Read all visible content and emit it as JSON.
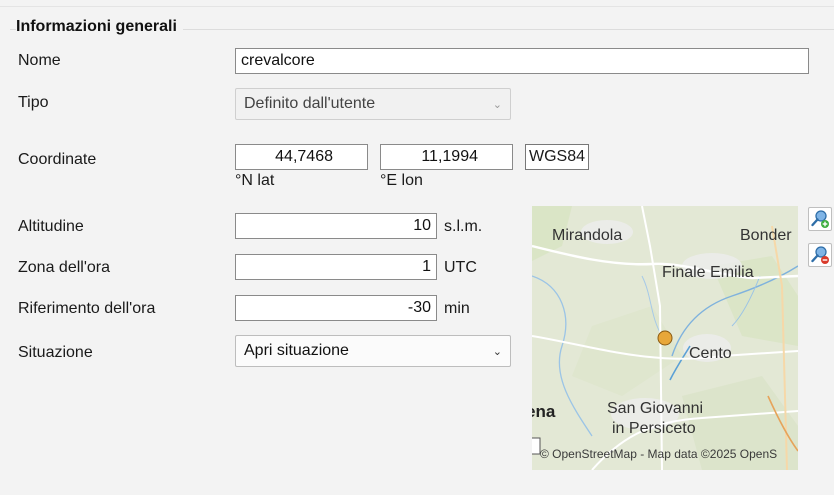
{
  "section": {
    "title": "Informazioni generali"
  },
  "fields": {
    "nome": {
      "label": "Nome",
      "value": "crevalcore"
    },
    "tipo": {
      "label": "Tipo",
      "value": "Definito dall'utente"
    },
    "coordinate": {
      "label": "Coordinate",
      "lat": "44,7468",
      "lat_unit": "°N lat",
      "lon": "11,1994",
      "lon_unit": "°E lon",
      "datum": "WGS84"
    },
    "altitudine": {
      "label": "Altitudine",
      "value": "10",
      "unit": "s.l.m."
    },
    "zona": {
      "label": "Zona dell'ora",
      "value": "1",
      "unit": "UTC"
    },
    "riferimento": {
      "label": "Riferimento dell'ora",
      "value": "-30",
      "unit": "min"
    },
    "situazione": {
      "label": "Situazione",
      "value": "Apri situazione"
    }
  },
  "map": {
    "places": [
      "Mirandola",
      "Bonder",
      "Finale Emilia",
      "Cento",
      "San Giovanni",
      "in Persiceto",
      "ena"
    ],
    "attribution": "© OpenStreetMap - Map data ©2025 OpenS",
    "marker_color": "#e8a73a",
    "buttons": [
      "zoom-in-icon",
      "zoom-out-icon"
    ]
  }
}
